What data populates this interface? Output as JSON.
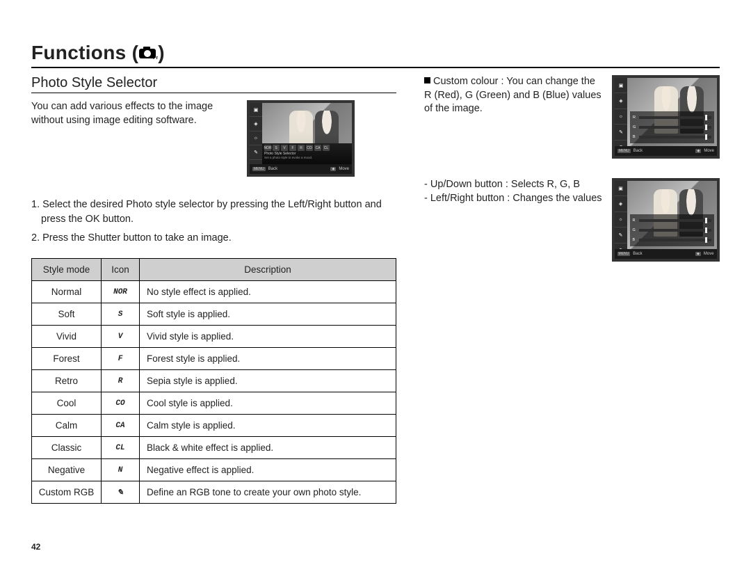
{
  "header": {
    "title": "Functions",
    "icon_name": "camera-fn-icon"
  },
  "left": {
    "subheading": "Photo Style Selector",
    "intro": "You can add various effects to the image without using image editing software.",
    "steps": [
      "1. Select the desired Photo style selector by pressing the Left/Right button and press the OK button.",
      "2. Press the Shutter button to take an image."
    ],
    "lcd1": {
      "strip_title": "Photo Style Selector",
      "strip_sub": "Set a photo style to evoke a mood.",
      "footer_back_key": "MENU",
      "footer_back": "Back",
      "footer_move_key": "◆",
      "footer_move": "Move",
      "icons": [
        "NOR",
        "S",
        "V",
        "F",
        "R",
        "CO",
        "CA",
        "CL"
      ]
    },
    "table": {
      "headers": {
        "mode": "Style mode",
        "icon": "Icon",
        "desc": "Description"
      },
      "rows": [
        {
          "mode": "Normal",
          "icon": "NOR",
          "desc": "No style effect is applied."
        },
        {
          "mode": "Soft",
          "icon": "S",
          "desc": "Soft style is applied."
        },
        {
          "mode": "Vivid",
          "icon": "V",
          "desc": "Vivid style is applied."
        },
        {
          "mode": "Forest",
          "icon": "F",
          "desc": "Forest style is applied."
        },
        {
          "mode": "Retro",
          "icon": "R",
          "desc": "Sepia style is applied."
        },
        {
          "mode": "Cool",
          "icon": "CO",
          "desc": "Cool style is applied."
        },
        {
          "mode": "Calm",
          "icon": "CA",
          "desc": "Calm style is applied."
        },
        {
          "mode": "Classic",
          "icon": "CL",
          "desc": "Black & white effect is applied."
        },
        {
          "mode": "Negative",
          "icon": "N",
          "desc": "Negative effect is applied."
        },
        {
          "mode": "Custom RGB",
          "icon": "✎",
          "desc": "Define an RGB tone to create your own photo style."
        }
      ]
    }
  },
  "right": {
    "custom_colour_label": "Custom colour : You can change the R (Red), G (Green) and B (Blue) values of the image.",
    "controls": [
      "- Up/Down button : Selects R, G, B",
      "- Left/Right button : Changes the values"
    ],
    "slider_labels": [
      "R",
      "G",
      "B"
    ],
    "lcd_footer": {
      "back_key": "MENU",
      "back": "Back",
      "move_key": "◆",
      "move": "Move"
    }
  },
  "page_number": "42"
}
